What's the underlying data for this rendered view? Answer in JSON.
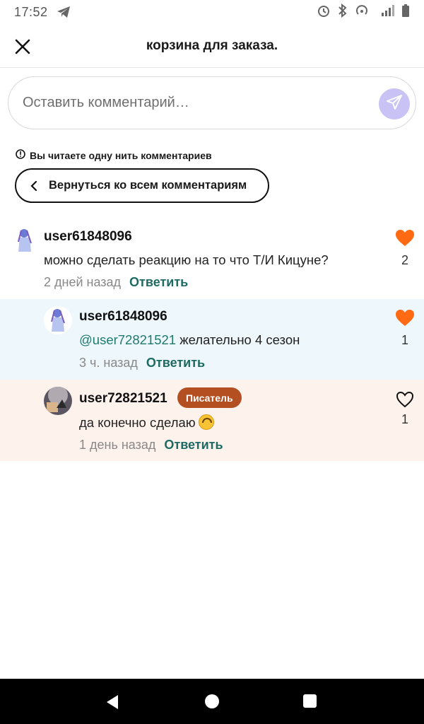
{
  "status_bar": {
    "time": "17:52"
  },
  "header": {
    "title": "корзина для заказа."
  },
  "comment_input": {
    "placeholder": "Оставить комментарий…"
  },
  "thread_notice": {
    "text": "Вы читаете одну нить комментариев",
    "back_label": "Вернуться ко всем комментариям"
  },
  "comments": [
    {
      "user": "user61848096",
      "text": "можно сделать реакцию на то что Т/И Кицуне?",
      "time": "2 дней назад",
      "reply_label": "Ответить",
      "likes": "2",
      "liked": true
    },
    {
      "user": "user61848096",
      "mention": "@user72821521",
      "text": " желательно 4 сезон",
      "time": "3 ч. назад",
      "reply_label": "Ответить",
      "likes": "1",
      "liked": true
    },
    {
      "user": "user72821521",
      "badge": "Писатель",
      "text": "да конечно сделаю",
      "time": "1 день назад",
      "reply_label": "Ответить",
      "likes": "1",
      "liked": false
    }
  ],
  "colors": {
    "accent_green": "#1d6b63",
    "like_orange": "#ff6a13",
    "badge_brown": "#b34f20",
    "send_purple": "#c8c2f5"
  },
  "icons": [
    "close-icon",
    "send-icon",
    "info-icon",
    "chevron-left-icon",
    "heart-icon",
    "nav-back-icon",
    "nav-home-icon",
    "nav-recents-icon"
  ]
}
